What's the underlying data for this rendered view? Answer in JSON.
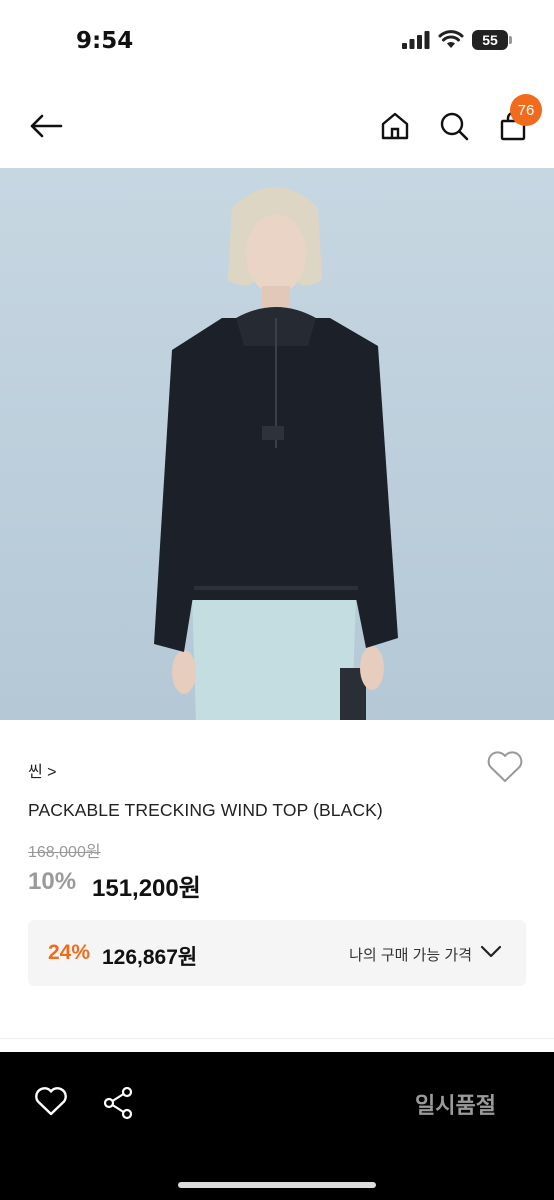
{
  "status_bar": {
    "time": "9:54",
    "battery": "55"
  },
  "nav": {
    "cart_count": "76"
  },
  "product": {
    "brand": "씬 >",
    "name": "PACKABLE TRECKING WIND TOP (BLACK)",
    "original_price": "168,000원",
    "discount_rate": "10%",
    "sale_price": "151,200원",
    "member": {
      "rate": "24%",
      "price": "126,867원",
      "label": "나의 구매 가능 가격"
    }
  },
  "bottom_bar": {
    "action_label": "일시품절"
  },
  "colors": {
    "accent": "#f26b1d",
    "bottom_bar": "#000000"
  }
}
